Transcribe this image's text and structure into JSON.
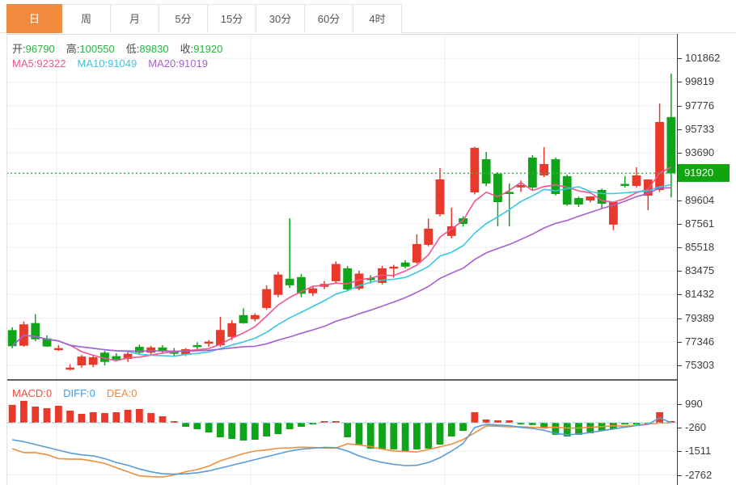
{
  "tabs": {
    "items": [
      {
        "label": "日",
        "active": true
      },
      {
        "label": "周",
        "active": false
      },
      {
        "label": "月",
        "active": false
      },
      {
        "label": "5分",
        "active": false
      },
      {
        "label": "15分",
        "active": false
      },
      {
        "label": "30分",
        "active": false
      },
      {
        "label": "60分",
        "active": false
      },
      {
        "label": "4时",
        "active": false
      }
    ]
  },
  "ohlc_legend": {
    "items": [
      {
        "label": "开:",
        "value": "96790"
      },
      {
        "label": "高:",
        "value": "100550"
      },
      {
        "label": "低:",
        "value": "89830"
      },
      {
        "label": "收:",
        "value": "91920"
      }
    ]
  },
  "ma_legend": {
    "items": [
      {
        "label": "MA5:",
        "value": "92322",
        "color": "#f0568f"
      },
      {
        "label": "MA10:",
        "value": "91049",
        "color": "#38c6e3"
      },
      {
        "label": "MA20:",
        "value": "91019",
        "color": "#a75fd1"
      }
    ]
  },
  "macd_legend": {
    "items": [
      {
        "label": "MACD:",
        "value": "0",
        "color": "#f04c3e"
      },
      {
        "label": "DIFF:",
        "value": "0",
        "color": "#3f9df0"
      },
      {
        "label": "DEA:",
        "value": "0",
        "color": "#f0883a"
      }
    ]
  },
  "colors": {
    "up": "#e8392a",
    "down": "#10a41a",
    "badge": "#0ea50e",
    "dotted_price_line": "#3cb347",
    "grid": "#edf0f6",
    "vgrid": "#e9edf4",
    "separator": "#2b2b2b",
    "ma5": "#f0568f",
    "ma10": "#38c6e3",
    "ma20": "#a75fd1",
    "diff_line": "#5b9bd5",
    "dea_line": "#ef8f3d",
    "zero_line": "#90d9e9",
    "tab_active_bg": "#f08b3d"
  },
  "chart_data": {
    "type": "candlestick+macd",
    "current_price": 91920,
    "current_price_label": "91920",
    "price_axis": {
      "max": 103980,
      "min": 74040,
      "ticks": [
        101862,
        99819,
        97776,
        95733,
        93690,
        89604,
        87561,
        85518,
        83475,
        81432,
        79389,
        77346,
        75303
      ],
      "grid_extra": [
        91647
      ]
    },
    "vertical_grid_x": [
      70,
      310,
      550,
      790
    ],
    "ma_periods": [
      5,
      10,
      20
    ],
    "candles": [
      [
        78350,
        78600,
        76780,
        76960
      ],
      [
        77000,
        79100,
        76900,
        78850
      ],
      [
        78960,
        79730,
        77400,
        77560
      ],
      [
        77630,
        77900,
        76900,
        76930
      ],
      [
        76740,
        77050,
        76550,
        76790
      ],
      [
        75000,
        75400,
        74850,
        75100
      ],
      [
        75300,
        76200,
        75100,
        76060
      ],
      [
        75350,
        76150,
        75150,
        76000
      ],
      [
        76400,
        76550,
        75300,
        75600
      ],
      [
        76100,
        76350,
        75650,
        75800
      ],
      [
        75850,
        76500,
        75600,
        76300
      ],
      [
        76900,
        77100,
        76200,
        76400
      ],
      [
        76400,
        77000,
        76250,
        76850
      ],
      [
        76850,
        77050,
        76300,
        76500
      ],
      [
        76500,
        76800,
        76100,
        76300
      ],
      [
        76250,
        76800,
        76100,
        76700
      ],
      [
        77050,
        77300,
        76700,
        76900
      ],
      [
        77200,
        77500,
        76900,
        77350
      ],
      [
        77050,
        79500,
        76900,
        78360
      ],
      [
        77760,
        79200,
        77500,
        78950
      ],
      [
        79650,
        80250,
        78900,
        78950
      ],
      [
        79300,
        79800,
        79100,
        79650
      ],
      [
        80270,
        82230,
        80100,
        81900
      ],
      [
        81400,
        83400,
        81200,
        83160
      ],
      [
        82800,
        88030,
        82000,
        82230
      ],
      [
        82940,
        83200,
        81200,
        81500
      ],
      [
        81540,
        82100,
        81300,
        81960
      ],
      [
        82100,
        82600,
        81900,
        82350
      ],
      [
        82580,
        84300,
        82400,
        84070
      ],
      [
        83700,
        83900,
        81700,
        81870
      ],
      [
        81940,
        83500,
        81800,
        83240
      ],
      [
        82850,
        83100,
        82400,
        82700
      ],
      [
        82440,
        83900,
        82300,
        83700
      ],
      [
        83840,
        84000,
        82900,
        83840
      ],
      [
        84200,
        84400,
        83700,
        83840
      ],
      [
        84200,
        86640,
        84100,
        85800
      ],
      [
        85730,
        88000,
        85600,
        87130
      ],
      [
        88380,
        92370,
        88200,
        91390
      ],
      [
        86500,
        88950,
        86300,
        87340
      ],
      [
        88030,
        88200,
        87300,
        87540
      ],
      [
        90270,
        94210,
        90100,
        94120
      ],
      [
        93140,
        93770,
        90800,
        91040
      ],
      [
        91880,
        92000,
        87340,
        89430
      ],
      [
        90300,
        91040,
        87340,
        90130
      ],
      [
        90700,
        91300,
        90300,
        90900
      ],
      [
        93280,
        93500,
        90500,
        90690
      ],
      [
        91740,
        94190,
        91600,
        92720
      ],
      [
        93140,
        93300,
        90000,
        90130
      ],
      [
        91670,
        91800,
        89100,
        89220
      ],
      [
        89780,
        89900,
        89000,
        89220
      ],
      [
        89570,
        89920,
        89400,
        89920
      ],
      [
        90480,
        90600,
        88900,
        89290
      ],
      [
        87480,
        89430,
        87000,
        89430
      ],
      [
        91000,
        91670,
        90700,
        90830
      ],
      [
        90830,
        92440,
        90700,
        91740
      ],
      [
        89990,
        91390,
        88730,
        91390
      ],
      [
        90480,
        97960,
        90300,
        96360
      ],
      [
        96790,
        100550,
        89830,
        91920
      ]
    ],
    "macd": {
      "axis": {
        "max": 2268,
        "min": -3296,
        "ticks": [
          990,
          -260,
          -1511,
          -2762
        ]
      },
      "bars": [
        945,
        1160,
        856,
        770,
        899,
        642,
        471,
        556,
        514,
        556,
        685,
        728,
        514,
        342,
        86,
        -214,
        -342,
        -513,
        -770,
        -856,
        -941,
        -899,
        -727,
        -599,
        -342,
        -214,
        -86,
        80,
        40,
        -770,
        -1150,
        -1370,
        -1410,
        -1410,
        -1500,
        -1410,
        -1370,
        -1155,
        -730,
        -430,
        560,
        170,
        130,
        130,
        -80,
        -120,
        -300,
        -640,
        -730,
        -640,
        -560,
        -430,
        -340,
        -90,
        -40,
        -20,
        560,
        10
      ],
      "diff": [
        -900,
        -1000,
        -1150,
        -1300,
        -1450,
        -1600,
        -1700,
        -1750,
        -1900,
        -2100,
        -2250,
        -2450,
        -2600,
        -2700,
        -2720,
        -2700,
        -2650,
        -2550,
        -2400,
        -2250,
        -2100,
        -1950,
        -1800,
        -1650,
        -1500,
        -1400,
        -1350,
        -1300,
        -1320,
        -1500,
        -1750,
        -1950,
        -2100,
        -2200,
        -2270,
        -2250,
        -2100,
        -1850,
        -1500,
        -1100,
        -250,
        -80,
        -120,
        -150,
        -250,
        -300,
        -400,
        -560,
        -640,
        -600,
        -520,
        -420,
        -330,
        -230,
        -150,
        -80,
        260,
        0
      ]
    }
  }
}
